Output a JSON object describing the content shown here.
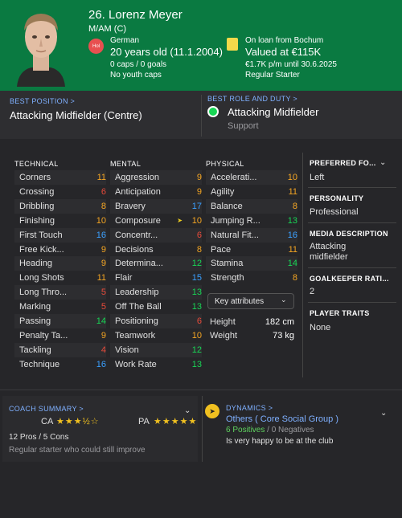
{
  "colors": {
    "header_bg": "#0a7a41",
    "high": "#18d655",
    "good": "#f5a623",
    "mid": "#e8d23a",
    "low": "#e84a3a",
    "blue": "#3aa0ff"
  },
  "header": {
    "name": "26. Lorenz Meyer",
    "position": "M/AM (C)",
    "nation_badge": "Hol",
    "nationality": "German",
    "age_text": "20 years old (11.1.2004)",
    "caps": "0 caps / 0 goals",
    "youth_caps": "No youth caps",
    "loan_text": "On loan from Bochum",
    "value_text": "Valued at €115K",
    "wage_text": "€1.7K p/m until 30.6.2025",
    "status_text": "Regular Starter"
  },
  "best_position": {
    "label": "BEST POSITION >",
    "value": "Attacking Midfielder (Centre)"
  },
  "best_role": {
    "label": "BEST ROLE AND DUTY >",
    "role": "Attacking Midfielder",
    "duty": "Support"
  },
  "technical": {
    "header": "TECHNICAL",
    "items": [
      {
        "name": "Corners",
        "value": "11",
        "color": "#f5a623"
      },
      {
        "name": "Crossing",
        "value": "6",
        "color": "#e84a3a"
      },
      {
        "name": "Dribbling",
        "value": "8",
        "color": "#f5a623"
      },
      {
        "name": "Finishing",
        "value": "10",
        "color": "#f5a623"
      },
      {
        "name": "First Touch",
        "value": "16",
        "color": "#3aa0ff"
      },
      {
        "name": "Free Kick...",
        "value": "9",
        "color": "#f5a623"
      },
      {
        "name": "Heading",
        "value": "9",
        "color": "#f5a623"
      },
      {
        "name": "Long Shots",
        "value": "11",
        "color": "#f5a623"
      },
      {
        "name": "Long Thro...",
        "value": "5",
        "color": "#e84a3a"
      },
      {
        "name": "Marking",
        "value": "5",
        "color": "#e84a3a"
      },
      {
        "name": "Passing",
        "value": "14",
        "color": "#18d655"
      },
      {
        "name": "Penalty Ta...",
        "value": "9",
        "color": "#f5a623"
      },
      {
        "name": "Tackling",
        "value": "4",
        "color": "#e84a3a"
      },
      {
        "name": "Technique",
        "value": "16",
        "color": "#3aa0ff"
      }
    ]
  },
  "mental": {
    "header": "MENTAL",
    "items": [
      {
        "name": "Aggression",
        "value": "9",
        "color": "#f5a623"
      },
      {
        "name": "Anticipation",
        "value": "9",
        "color": "#f5a623"
      },
      {
        "name": "Bravery",
        "value": "17",
        "color": "#3aa0ff"
      },
      {
        "name": "Composure",
        "value": "10",
        "color": "#f5a623"
      },
      {
        "name": "Concentr...",
        "value": "6",
        "color": "#e84a3a"
      },
      {
        "name": "Decisions",
        "value": "8",
        "color": "#f5a623"
      },
      {
        "name": "Determina...",
        "value": "12",
        "color": "#18d655"
      },
      {
        "name": "Flair",
        "value": "15",
        "color": "#3aa0ff"
      },
      {
        "name": "Leadership",
        "value": "13",
        "color": "#18d655"
      },
      {
        "name": "Off The Ball",
        "value": "13",
        "color": "#18d655"
      },
      {
        "name": "Positioning",
        "value": "6",
        "color": "#e84a3a"
      },
      {
        "name": "Teamwork",
        "value": "10",
        "color": "#f5a623"
      },
      {
        "name": "Vision",
        "value": "12",
        "color": "#18d655"
      },
      {
        "name": "Work Rate",
        "value": "13",
        "color": "#18d655"
      }
    ]
  },
  "physical": {
    "header": "PHYSICAL",
    "items": [
      {
        "name": "Accelerati...",
        "value": "10",
        "color": "#f5a623"
      },
      {
        "name": "Agility",
        "value": "11",
        "color": "#f5a623"
      },
      {
        "name": "Balance",
        "value": "8",
        "color": "#f5a623"
      },
      {
        "name": "Jumping R...",
        "value": "13",
        "color": "#18d655"
      },
      {
        "name": "Natural Fit...",
        "value": "16",
        "color": "#3aa0ff"
      },
      {
        "name": "Pace",
        "value": "11",
        "color": "#f5a623"
      },
      {
        "name": "Stamina",
        "value": "14",
        "color": "#18d655"
      },
      {
        "name": "Strength",
        "value": "8",
        "color": "#f5a623"
      }
    ],
    "key_attributes_label": "Key attributes",
    "height_label": "Height",
    "height_value": "182 cm",
    "weight_label": "Weight",
    "weight_value": "73 kg"
  },
  "info": {
    "preferred_foot_label": "PREFERRED FO...",
    "preferred_foot_value": "Left",
    "personality_label": "PERSONALITY",
    "personality_value": "Professional",
    "media_label": "MEDIA DESCRIPTION",
    "media_value_1": "Attacking",
    "media_value_2": "midfielder",
    "gk_label": "GOALKEEPER RATI...",
    "gk_value": "2",
    "traits_label": "PLAYER TRAITS",
    "traits_value": "None"
  },
  "coach": {
    "label": "COACH SUMMARY >",
    "ca_label": "CA",
    "ca_stars": "★★★½☆",
    "ca_rating": 3.5,
    "pa_label": "PA",
    "pa_stars": "★★★★★",
    "pa_rating": 5,
    "pros_cons": "12 Pros / 5 Cons",
    "note": "Regular starter who could still improve"
  },
  "dynamics": {
    "label": "DYNAMICS >",
    "group": "Others ( Core Social Group )",
    "positives": "6 Positives",
    "separator": " / ",
    "negatives": "0 Negatives",
    "note": "Is very happy to be at the club"
  }
}
